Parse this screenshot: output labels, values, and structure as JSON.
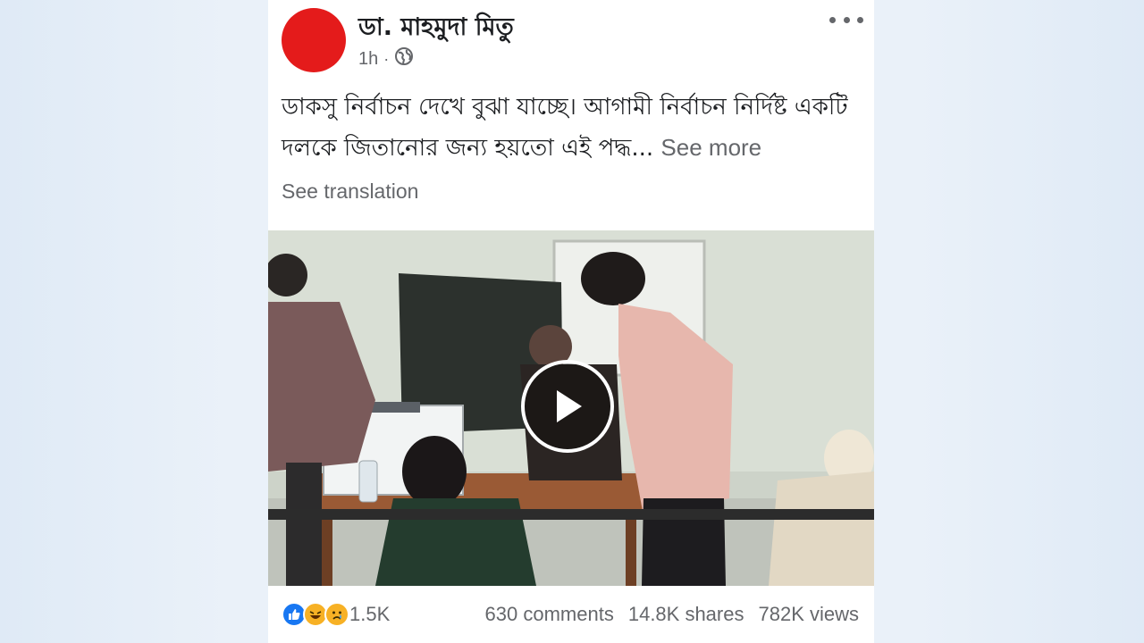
{
  "post": {
    "author": "ডা. মাহমুদা মিতু",
    "time": "1h",
    "separator": "·",
    "text": "ডাকসু নির্বাচন দেখে বুঝা যাচ্ছে।  আগামী নির্বাচন নির্দিষ্ট একটি দলকে জিতানোর জন্য হয়তো এই পদ্ধ...",
    "see_more": "See more",
    "see_translation": "See translation"
  },
  "stats": {
    "reactions": "1.5K",
    "comments": "630 comments",
    "shares": "14.8K shares",
    "views": "782K views"
  },
  "colors": {
    "avatar": "#e41b1b",
    "like": "#1877f2",
    "emoji": "#f7b125"
  }
}
